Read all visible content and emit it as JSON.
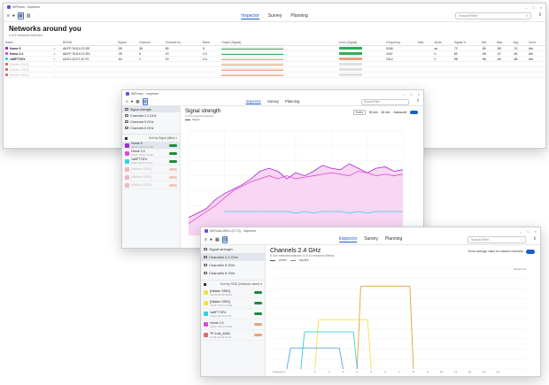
{
  "win1": {
    "title": "WiFiman - Inspector",
    "tabs": [
      "Inspector",
      "Survey",
      "Planning"
    ],
    "search_placeholder": "Search/Filter",
    "heading": "Networks around you",
    "subheading": "4 of 8 networks selected",
    "columns": [
      "Name",
      "",
      "BSSID",
      "Signal",
      "Channel",
      "Channel wi...",
      "Band",
      "Graph (Signal)",
      "Level (Signal)",
      "Frequency",
      "Max",
      "Mode",
      "Signal %",
      "Min",
      "Max",
      "Avg",
      "Vend"
    ],
    "rows": [
      {
        "color": "#a22bd0",
        "name": "Home 5",
        "bssid": "A8:FF:76:D1:CC:EE",
        "signal": "-55",
        "channel": "36",
        "width": "80",
        "band": "5",
        "freq": "5180",
        "mode": "ac",
        "pct": "72",
        "min": "-80",
        "max": "-55",
        "avg": "-70",
        "vend": "Ubi",
        "bar": "#2fae5b",
        "dim": false
      },
      {
        "color": "#e04ad1",
        "name": "Home 2.4",
        "bssid": "A8:FF:76:D1:CC:ED",
        "signal": "-39",
        "channel": "6",
        "width": "20",
        "band": "2.4",
        "freq": "2437",
        "mode": "n",
        "pct": "83",
        "min": "-96",
        "max": "-37",
        "avg": "-54",
        "vend": "Ubi",
        "bar": "#2fae5b",
        "dim": false
      },
      {
        "color": "#2fd3d8",
        "name": "1a5F771Fe",
        "bssid": "A4:E1:1D:07:1C:F0",
        "signal": "-64",
        "channel": "1",
        "width": "20",
        "band": "2.4",
        "freq": "2412",
        "mode": "n",
        "pct": "58",
        "min": "-96",
        "max": "-60",
        "avg": "-68",
        "vend": "Ubi",
        "bar": "#e8a27a",
        "dim": false
      },
      {
        "color": "#e56a6a",
        "name": "[Hidden SSID]",
        "bssid": "",
        "signal": "",
        "channel": "",
        "width": "",
        "band": "",
        "freq": "",
        "mode": "",
        "pct": "",
        "min": "",
        "max": "",
        "avg": "",
        "vend": "",
        "bar": "#e8a27a",
        "dim": true
      },
      {
        "color": "#e56a6a",
        "name": "[Hidden SSID]",
        "bssid": "",
        "signal": "",
        "channel": "",
        "width": "",
        "band": "",
        "freq": "",
        "mode": "",
        "pct": "",
        "min": "",
        "max": "",
        "avg": "",
        "vend": "",
        "bar": "#e8a27a",
        "dim": true
      },
      {
        "color": "#e56a6a",
        "name": "[Hidden SSID]",
        "bssid": "",
        "signal": "",
        "channel": "",
        "width": "",
        "band": "",
        "freq": "",
        "mode": "",
        "pct": "",
        "min": "",
        "max": "",
        "avg": "",
        "vend": "",
        "bar": "#e8a27a",
        "dim": true
      }
    ]
  },
  "win2": {
    "title": "WiFiman - Inspector",
    "tabs": [
      "Inspector",
      "Survey",
      "Planning"
    ],
    "search_placeholder": "Search/Filter",
    "side_items": [
      "Signal strength",
      "Channels 2.4 GHz",
      "Channels 5 GHz",
      "Channels 6 GHz"
    ],
    "sort_label": "Sort by Signal (dBm)",
    "nets": [
      {
        "name": "Home 5",
        "sub": "A8:FF:76:D1:CC:EE",
        "color": "#a22bd0",
        "sel": true,
        "dim": false
      },
      {
        "name": "Home 2.4",
        "sub": "A8:FF:76:D1:CC:ED",
        "color": "#e04ad1",
        "sel": false,
        "dim": false
      },
      {
        "name": "1a5F771Fe",
        "sub": "A4:E1:1D:07:1C:F0",
        "color": "#2fd3d8",
        "sel": false,
        "dim": false
      },
      {
        "name": "[Hidden SSID]",
        "sub": "",
        "color": "#e56a6a",
        "sel": false,
        "dim": true
      },
      {
        "name": "[Hidden SSID]",
        "sub": "",
        "color": "#e56a6a",
        "sel": false,
        "dim": true
      },
      {
        "name": "[Hidden SSID]",
        "sub": "",
        "color": "#e56a6a",
        "sel": false,
        "dim": true
      }
    ],
    "heading": "Signal strength",
    "subheading": "4 of 8 networks selected",
    "legend": "Signal",
    "time_opts": [
      "5 min",
      "30 min",
      "60 min"
    ],
    "autoscroll": "Autoscroll"
  },
  "win3": {
    "title": "WiFiman Wifi 4 (0.7.5) - Inspector",
    "tabs": [
      "Inspector",
      "Survey",
      "Planning"
    ],
    "search_placeholder": "Search/Filter",
    "side_items": [
      "Signal strength",
      "Channels 2.4 GHz",
      "Channels 5 GHz",
      "Channels 6 GHz"
    ],
    "sort_label": "Sort by SSID (Network name)",
    "nets": [
      {
        "name": "[Hidden SSID]",
        "sub": "A6:CB:2E:B5:A5:84",
        "color": "#f4e04a"
      },
      {
        "name": "[Hidden SSID]",
        "sub": "A4:FF:76:D1:CC:EE",
        "color": "#f4e04a"
      },
      {
        "name": "1a5F771Fe",
        "sub": "A4:E1:1D:07:1C:F0",
        "color": "#2fd3d8"
      },
      {
        "name": "Home 2.4",
        "sub": "A8:FF:76:D1:CC:ED",
        "color": "#e04ad1"
      },
      {
        "name": "TP-Link_A264",
        "sub": "C4:6E:1F:A5:A2:64",
        "color": "#e56a6a"
      }
    ],
    "heading": "Channels 2.4 GHz",
    "subheading": "5 of 8 networks selected, 5 of 10 networks filtered",
    "show_avg": "Show average value for inactive networks",
    "legend_active": "Active",
    "legend_inactive": "Inactive",
    "xlabel": "Frequency",
    "ylabel": "Signal level"
  },
  "chart_data": [
    {
      "type": "line",
      "title": "Signal strength",
      "ylim": [
        -100,
        -30
      ],
      "series": [
        {
          "name": "Home 5",
          "color": "#a22bd0",
          "values": [
            -88,
            -85,
            -82,
            -76,
            -72,
            -69,
            -66,
            -62,
            -57,
            -55,
            -57,
            -62,
            -58,
            -60,
            -57,
            -53,
            -55,
            -56,
            -52,
            -55,
            -58,
            -55,
            -54,
            -57,
            -56
          ]
        },
        {
          "name": "Home 2.4",
          "color": "#e04ad1",
          "values": [
            -92,
            -88,
            -84,
            -80,
            -75,
            -70,
            -67,
            -64,
            -62,
            -60,
            -62,
            -60,
            -62,
            -61,
            -60,
            -59,
            -58,
            -59,
            -60,
            -57,
            -58,
            -60,
            -59,
            -60,
            -59
          ]
        },
        {
          "name": "1a5F771Fe",
          "color": "#2fd3d8",
          "values": [
            null,
            null,
            null,
            null,
            -84,
            -84,
            -84,
            -84,
            -84,
            -84,
            -84,
            -84,
            -85,
            -84,
            -85,
            -84,
            -84,
            -84,
            -85,
            -84,
            -85,
            -84,
            -84,
            -84,
            -84
          ]
        }
      ]
    },
    {
      "type": "area",
      "title": "Channels 2.4 GHz",
      "channels": [
        1,
        2,
        3,
        4,
        5,
        6,
        7,
        8,
        9,
        10,
        11,
        12,
        13,
        14
      ],
      "networks": [
        {
          "name": "Home 2.4",
          "color": "#e0a13a",
          "center_channel": 6,
          "width_mhz": 20,
          "level": -39
        },
        {
          "name": "[Hidden SSID]",
          "color": "#f4e04a",
          "center_channel": 3,
          "width_mhz": 20,
          "level": -64
        },
        {
          "name": "1a5F771Fe",
          "color": "#2fd3d8",
          "center_channel": 2,
          "width_mhz": 20,
          "level": -73
        },
        {
          "name": "TP-Link_A264",
          "color": "#5aa7e0",
          "center_channel": 1,
          "width_mhz": 20,
          "level": -85
        }
      ]
    }
  ]
}
